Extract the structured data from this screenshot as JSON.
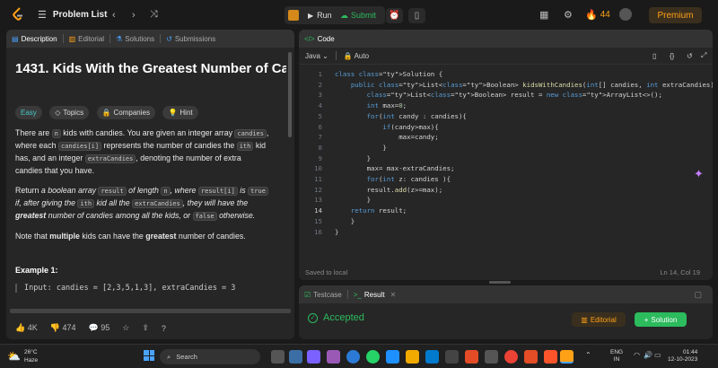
{
  "topbar": {
    "title": "Problem List",
    "run": "Run",
    "submit": "Submit",
    "streak": "44",
    "premium": "Premium"
  },
  "desc_panel": {
    "tabs": [
      "Description",
      "Editorial",
      "Solutions",
      "Submissions"
    ],
    "title": "1431. Kids With the Greatest Number of Ca",
    "chips": [
      "Easy",
      "Topics",
      "Companies",
      "Hint"
    ],
    "p1": {
      "a": "There are ",
      "n": "n",
      "b": " kids with candies. You are given an integer array ",
      "candies": "candies",
      "c": ",",
      "d": "where each ",
      "ci": "candies[i]",
      "e": " represents the number of candies the ",
      "ith": "ith",
      "f": " kid",
      "g": "has, and an integer ",
      "extra": "extraCandies",
      "h": ", denoting the number of extra",
      "i": "candies that you have."
    },
    "p2": {
      "a": "Return ",
      "b": "a boolean array ",
      "result": "result",
      "c": " of length ",
      "n": "n",
      "d": ", where ",
      "ri": "result[i]",
      "e": " is ",
      "true": "true",
      "f": "if, after giving the ",
      "ith": "ith",
      "g": " kid all the ",
      "extra": "extraCandies",
      "h": ", they will have the",
      "greatest": "greatest",
      "i": " number of candies among all the kids, or ",
      "false": "false",
      "j": " otherwise."
    },
    "p3": {
      "a": "Note that ",
      "multiple": "multiple",
      "b": " kids can have the ",
      "greatest": "greatest",
      "c": " number of candies."
    },
    "example_title": "Example 1:",
    "example_input": "Input: candies = [2,3,5,1,3], extraCandies = 3",
    "footer": {
      "likes": "4K",
      "dislikes": "474",
      "comments": "95"
    }
  },
  "code_panel": {
    "title": "Code",
    "language": "Java",
    "mode": "Auto",
    "lines": [
      "class Solution {",
      "    public List<Boolean> kidsWithCandies(int[] candies, int extraCandies) {",
      "        List<Boolean> result = new ArrayList<>();",
      "        int max=0;",
      "        for(int candy : candies){",
      "            if(candy>max){",
      "                max=candy;",
      "            }",
      "        }",
      "        max= max-extraCandies;",
      "        for(int z: candies ){",
      "        result.add(z>=max);",
      "        }",
      "    return result;",
      "    }",
      "}"
    ],
    "status_left": "Saved to local",
    "status_right": "Ln 14, Col 19"
  },
  "result_panel": {
    "tabs": [
      "Testcase",
      "Result"
    ],
    "status": "Accepted",
    "editorial": "Editorial",
    "solution": "Solution"
  },
  "taskbar": {
    "temp": "26°C",
    "weather": "Haze",
    "search": "Search",
    "lang1": "ENG",
    "lang2": "IN",
    "time": "01:44",
    "date": "12-10-2023"
  },
  "colors": {
    "accent": "#ffa116",
    "green": "#2cbb5d",
    "bg": "#1a1a1a",
    "panel": "#262626"
  }
}
